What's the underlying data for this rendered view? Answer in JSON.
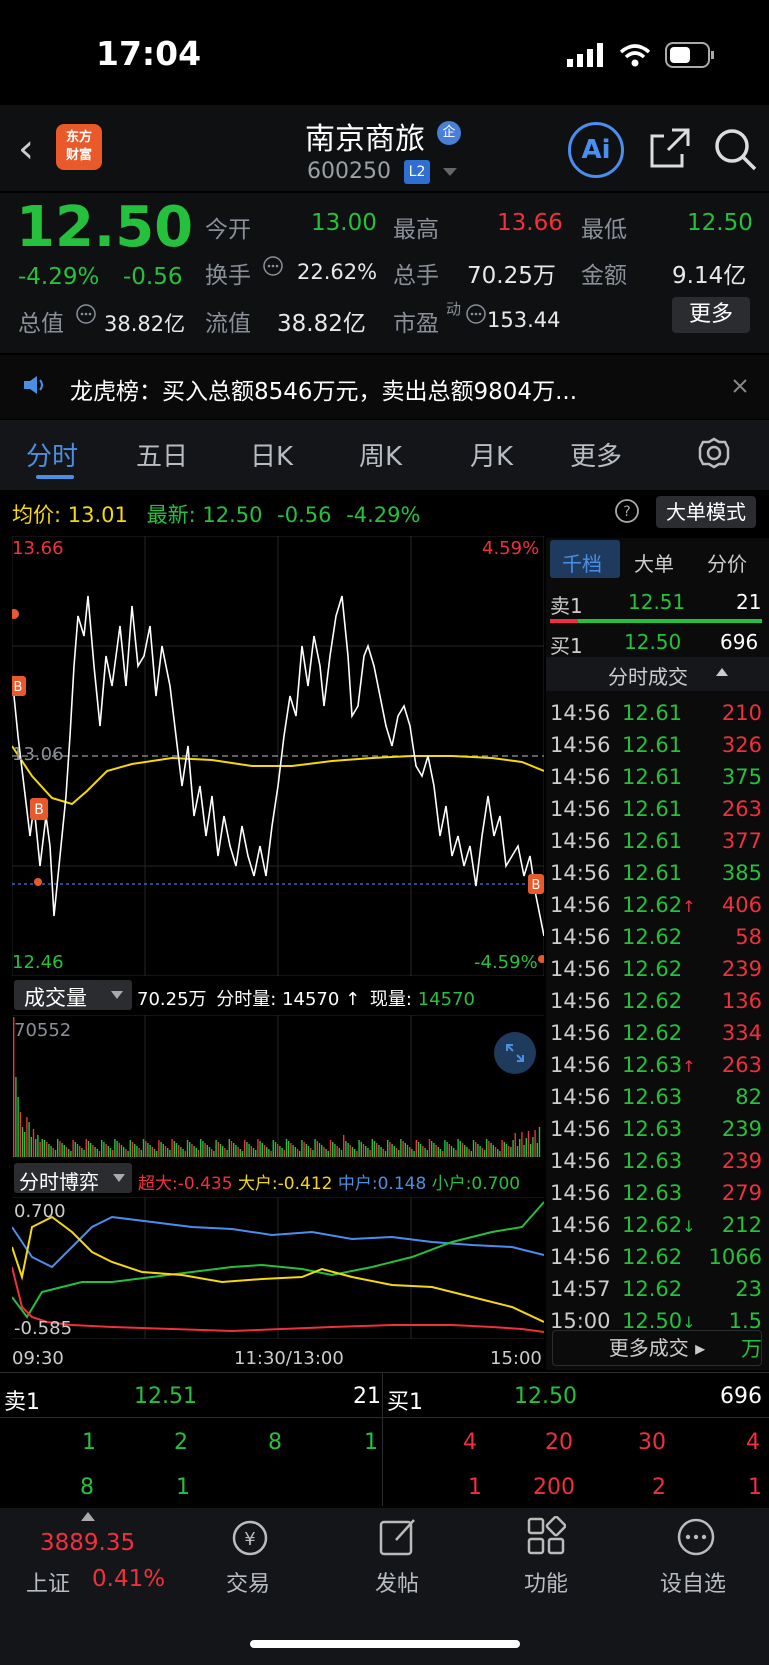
{
  "status": {
    "time": "17:04"
  },
  "header": {
    "back": "‹",
    "logo_line1": "东方",
    "logo_line2": "财富",
    "name": "南京商旅",
    "badge": "企",
    "code": "600250",
    "level": "L2",
    "ai": "Ai"
  },
  "quote": {
    "price": "12.50",
    "change_pct": "-4.29%",
    "change": "-0.56",
    "open_label": "今开",
    "open": "13.00",
    "high_label": "最高",
    "high": "13.66",
    "low_label": "最低",
    "low": "12.50",
    "turnover_label": "换手",
    "turnover": "22.62%",
    "volume_label": "总手",
    "volume": "70.25万",
    "amount_label": "金额",
    "amount": "9.14亿",
    "mktcap_label": "总值",
    "mktcap": "38.82亿",
    "float_label": "流值",
    "float": "38.82亿",
    "pe_label": "市盈",
    "pe_sup": "动",
    "pe": "153.44",
    "more": "更多"
  },
  "news": {
    "text": "龙虎榜：买入总额8546万元，卖出总额9804万..."
  },
  "tabs": [
    "分时",
    "五日",
    "日K",
    "周K",
    "月K",
    "更多"
  ],
  "avg": {
    "label": "均价:",
    "value": "13.01",
    "latest_label": "最新:",
    "latest": "12.50",
    "chg": "-0.56",
    "pct": "-4.29%"
  },
  "dadan": "大单模式",
  "chart_data": {
    "type": "line",
    "y_top": "13.66",
    "y_bottom": "12.46",
    "pct_top": "4.59%",
    "pct_bottom": "-4.59%",
    "prev_close": "13.06",
    "x_labels": [
      "09:30",
      "11:30/13:00",
      "15:00"
    ]
  },
  "volume": {
    "label": "成交量",
    "total": "70.25万",
    "fs_label": "分时量:",
    "fs": "14570",
    "now_label": "现量:",
    "now": "14570",
    "max": "70552"
  },
  "game": {
    "label": "分时博弈",
    "chaoda": "超大:-0.435",
    "dahu": "大户:-0.412",
    "zhonghu": "中户:0.148",
    "xiaohu": "小户:0.700",
    "top": "0.700",
    "bottom": "-0.585"
  },
  "right": {
    "tabs": [
      "千档",
      "大单",
      "分价"
    ],
    "sell1": {
      "label": "卖1",
      "price": "12.51",
      "vol": "21"
    },
    "buy1": {
      "label": "买1",
      "price": "12.50",
      "vol": "696"
    },
    "fs_title": "分时成交",
    "trades": [
      {
        "t": "14:56",
        "p": "12.61",
        "v": "210",
        "c": "red"
      },
      {
        "t": "14:56",
        "p": "12.61",
        "v": "326",
        "c": "red"
      },
      {
        "t": "14:56",
        "p": "12.61",
        "v": "375",
        "c": "green"
      },
      {
        "t": "14:56",
        "p": "12.61",
        "v": "263",
        "c": "red"
      },
      {
        "t": "14:56",
        "p": "12.61",
        "v": "377",
        "c": "red"
      },
      {
        "t": "14:56",
        "p": "12.61",
        "v": "385",
        "c": "green"
      },
      {
        "t": "14:56",
        "p": "12.62↑",
        "v": "406",
        "c": "red"
      },
      {
        "t": "14:56",
        "p": "12.62",
        "v": "58",
        "c": "red"
      },
      {
        "t": "14:56",
        "p": "12.62",
        "v": "239",
        "c": "red"
      },
      {
        "t": "14:56",
        "p": "12.62",
        "v": "136",
        "c": "red"
      },
      {
        "t": "14:56",
        "p": "12.62",
        "v": "334",
        "c": "red"
      },
      {
        "t": "14:56",
        "p": "12.63↑",
        "v": "263",
        "c": "red"
      },
      {
        "t": "14:56",
        "p": "12.63",
        "v": "82",
        "c": "green"
      },
      {
        "t": "14:56",
        "p": "12.63",
        "v": "239",
        "c": "green"
      },
      {
        "t": "14:56",
        "p": "12.63",
        "v": "239",
        "c": "red"
      },
      {
        "t": "14:56",
        "p": "12.63",
        "v": "279",
        "c": "red"
      },
      {
        "t": "14:56",
        "p": "12.62↓",
        "v": "212",
        "c": "green"
      },
      {
        "t": "14:56",
        "p": "12.62",
        "v": "1066",
        "c": "green"
      },
      {
        "t": "14:57",
        "p": "12.62",
        "v": "23",
        "c": "green"
      },
      {
        "t": "15:00",
        "p": "12.50↓",
        "v": "1.5万",
        "c": "green"
      }
    ],
    "more_trades": "更多成交"
  },
  "depth": {
    "sell_label": "卖1",
    "sell_price": "12.51",
    "sell_vol": "21",
    "buy_label": "买1",
    "buy_price": "12.50",
    "buy_vol": "696",
    "sell_row1": [
      "1",
      "2",
      "8",
      "1"
    ],
    "sell_row2": [
      "8",
      "1"
    ],
    "buy_row1": [
      "4",
      "20",
      "30",
      "4"
    ],
    "buy_row2": [
      "1",
      "200",
      "2",
      "1"
    ]
  },
  "tabbar": {
    "index_value": "3889.35",
    "index_name": "上证",
    "index_pct": "0.41%",
    "trade": "交易",
    "post": "发帖",
    "func": "功能",
    "watch": "设自选"
  }
}
